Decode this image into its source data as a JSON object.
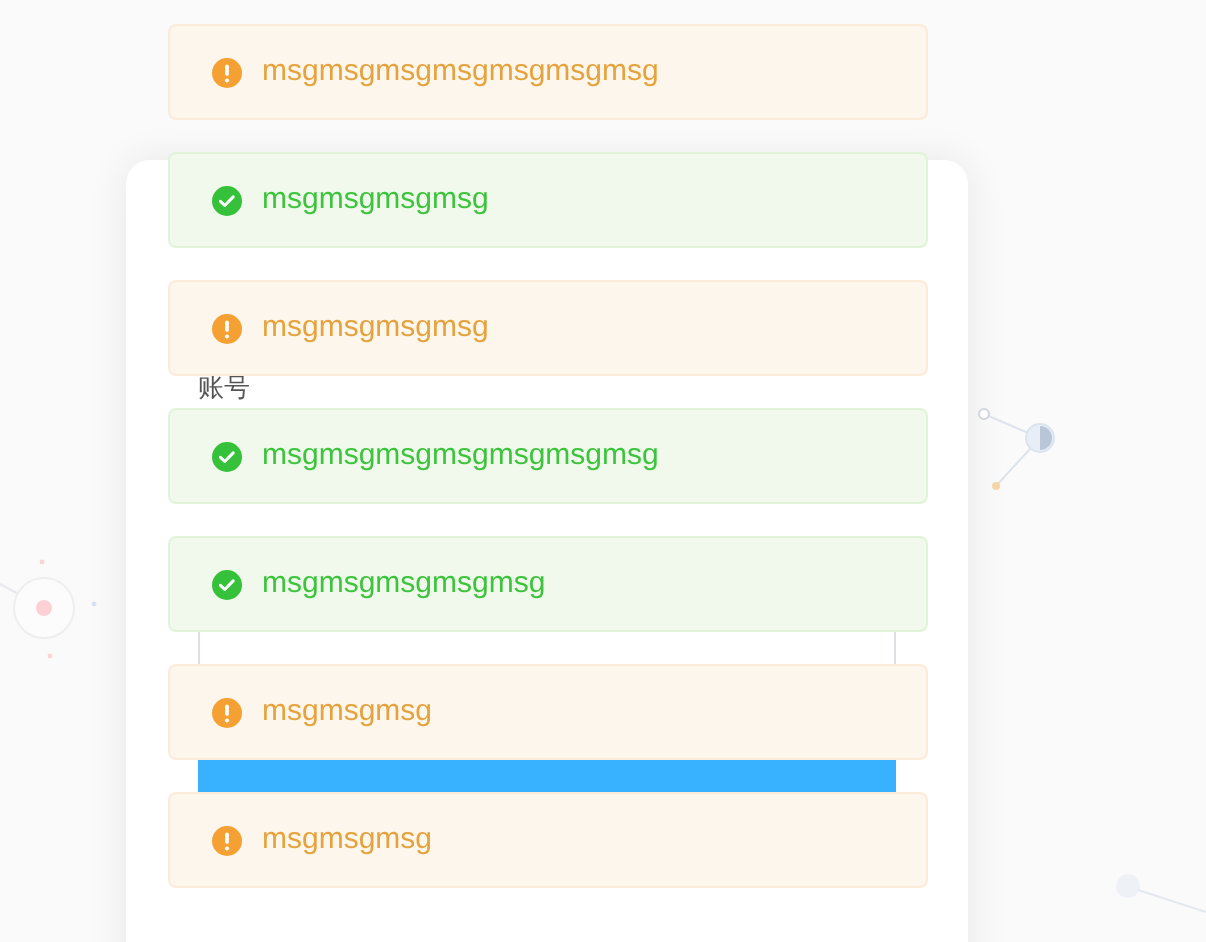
{
  "login": {
    "account_label": "账号"
  },
  "messages": [
    {
      "kind": "warning",
      "text": "msgmsgmsgmsgmsgmsgmsg"
    },
    {
      "kind": "success",
      "text": "msgmsgmsgmsg"
    },
    {
      "kind": "warning",
      "text": "msgmsgmsgmsg"
    },
    {
      "kind": "success",
      "text": "msgmsgmsgmsgmsgmsgmsg"
    },
    {
      "kind": "success",
      "text": "msgmsgmsgmsgmsg"
    },
    {
      "kind": "warning",
      "text": "msgmsgmsg"
    },
    {
      "kind": "warning",
      "text": "msgmsgmsg"
    }
  ]
}
